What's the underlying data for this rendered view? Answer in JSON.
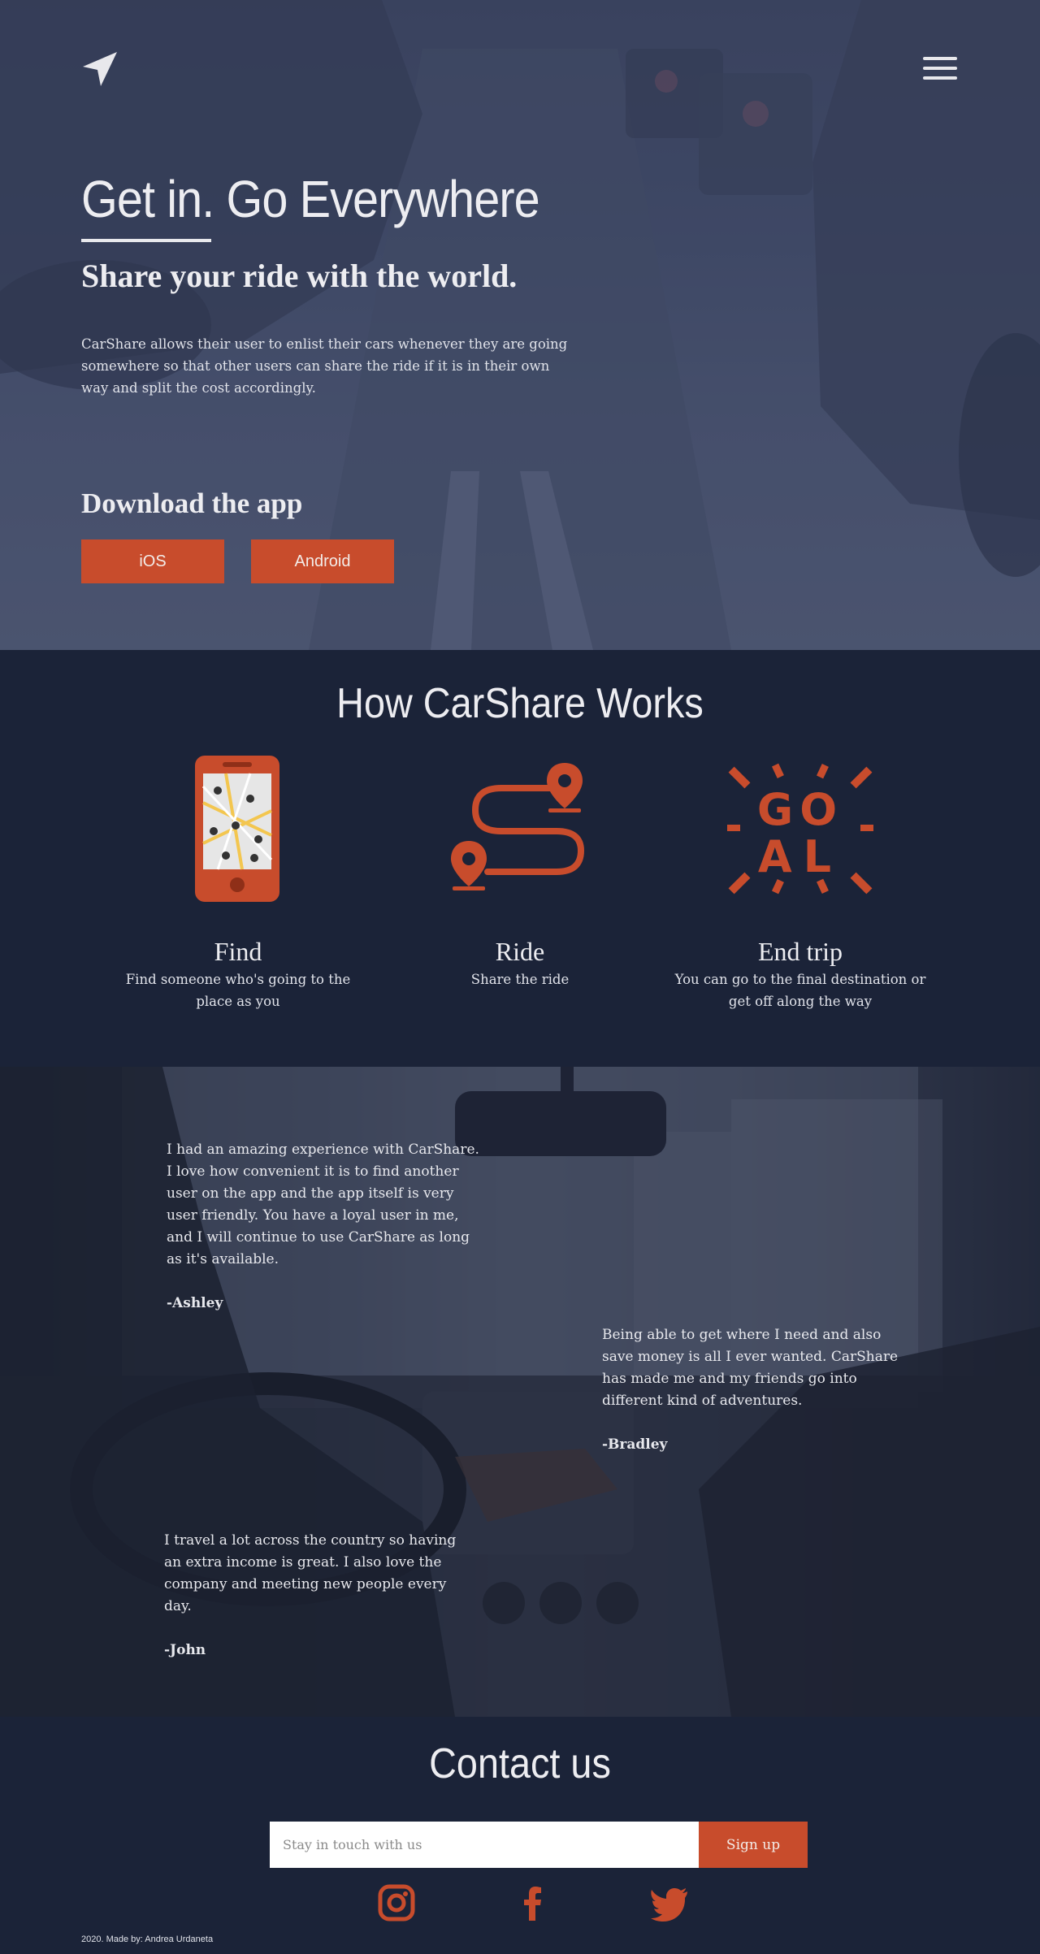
{
  "colors": {
    "accent": "#c84c2c",
    "background": "#1b2338",
    "text": "#ededf1"
  },
  "header": {
    "logo_icon": "navigation-arrow-icon",
    "menu_icon": "hamburger-menu-icon"
  },
  "hero": {
    "title": "Get in. Go Everywhere",
    "subtitle": "Share your ride with the world.",
    "description": "CarShare allows their user to enlist their cars whenever they are going somewhere so that other users can share the ride if it is in their own way and split the cost accordingly.",
    "download_title": "Download the app",
    "ios_label": "iOS",
    "android_label": "Android"
  },
  "how": {
    "title": "How CarShare Works",
    "steps": [
      {
        "name": "Find",
        "desc": "Find someone who's going to the place as you",
        "icon": "phone-map-icon"
      },
      {
        "name": "Ride",
        "desc": "Share the ride",
        "icon": "route-pins-icon"
      },
      {
        "name": "End trip",
        "desc": "You can go to the final destination or get off along the way",
        "icon": "goal-icon"
      }
    ]
  },
  "testimonials": [
    {
      "text": "I had an amazing experience with CarShare. I love how convenient it is to find another user on the app and the app itself is very user friendly. You have a loyal user in me, and I will continue to use CarShare as long as it's available.",
      "author": "-Ashley"
    },
    {
      "text": "Being able to get where I need and also save money is all I ever wanted. CarShare has made me and my friends go into different kind of adventures.",
      "author": "-Bradley"
    },
    {
      "text": "I travel a lot across the country so having an extra income is great. I also love the company and meeting new people every day.",
      "author": "-John"
    }
  ],
  "contact": {
    "title": "Contact us",
    "input_placeholder": "Stay in touch with us",
    "signup_label": "Sign up",
    "social": [
      "instagram-icon",
      "facebook-icon",
      "twitter-icon"
    ]
  },
  "footer": {
    "note": "2020. Made by: Andrea Urdaneta"
  }
}
